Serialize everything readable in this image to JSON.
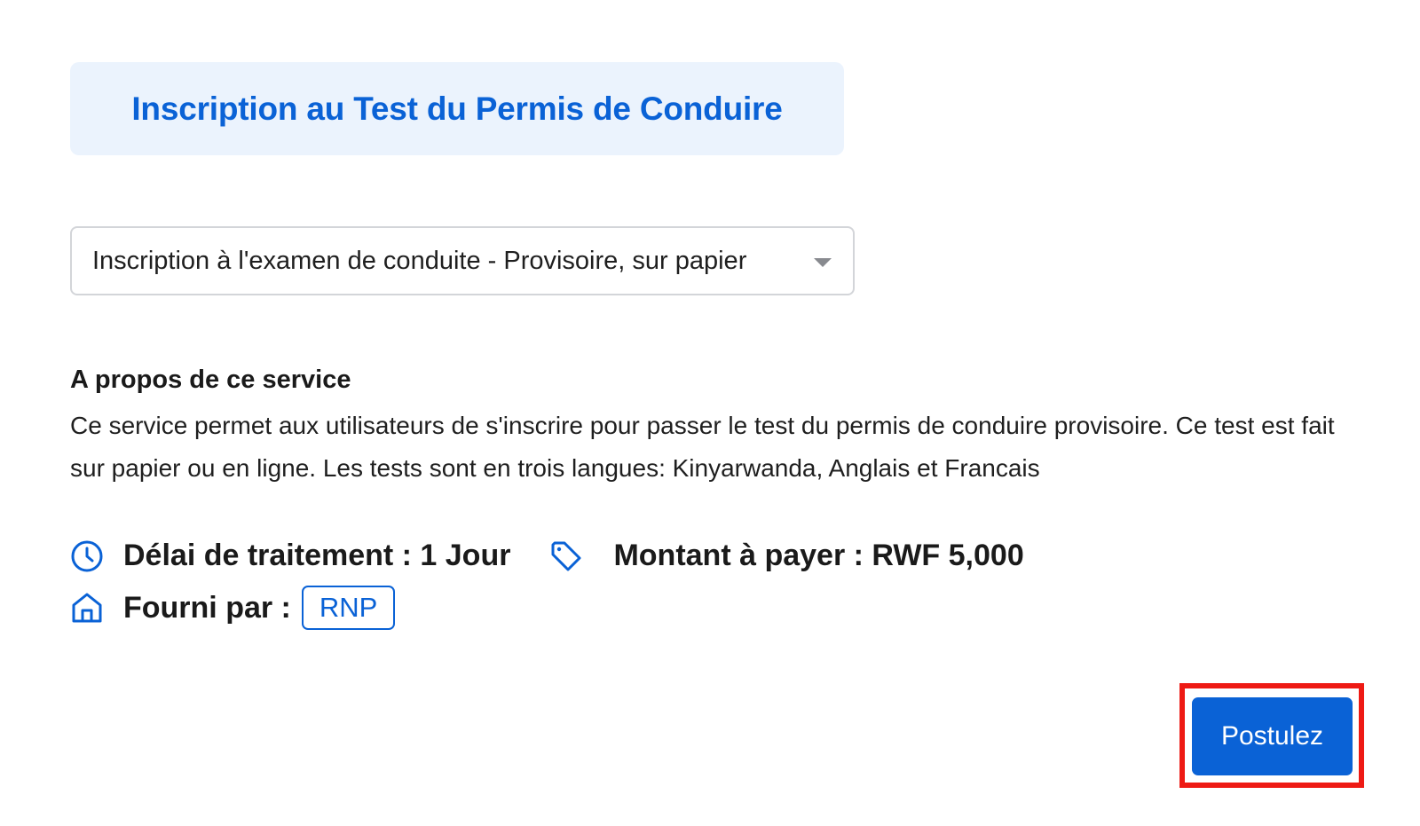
{
  "header": {
    "title": "Inscription au Test du Permis de Conduire"
  },
  "service_select": {
    "selected_value": "Inscription à l'examen de conduite - Provisoire, sur papier"
  },
  "about": {
    "heading": "A propos de ce service",
    "description": "Ce service permet aux utilisateurs de s'inscrire pour passer le test du permis de conduire provisoire. Ce test est fait sur papier ou en ligne. Les tests sont en trois langues: Kinyarwanda, Anglais et Francais"
  },
  "meta": {
    "processing_time": "Délai de traitement : 1 Jour",
    "amount": "Montant à payer : RWF 5,000",
    "provider_label": "Fourni par :",
    "provider": "RNP"
  },
  "actions": {
    "apply_label": "Postulez"
  },
  "icons": {
    "processing_time": "clock-icon",
    "amount": "tag-icon",
    "provider": "home-icon"
  },
  "colors": {
    "accent": "#0a62d6",
    "title_background": "#ebf3fd",
    "highlight": "#ee1a14"
  }
}
